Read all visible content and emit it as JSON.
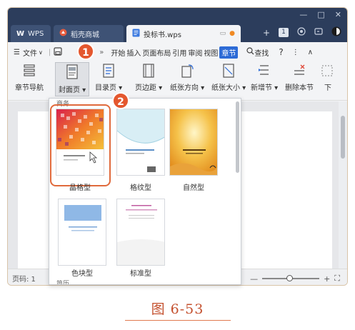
{
  "titlebar": {
    "tabs": [
      {
        "label": "WPS"
      },
      {
        "label": "稻壳商城"
      },
      {
        "label": "投标书.wps"
      }
    ],
    "window_controls": [
      "—",
      "□",
      "✕"
    ],
    "tab_count": "1"
  },
  "menu": {
    "file_label": "文件",
    "items": [
      "开始",
      "插入",
      "页面布局",
      "引用",
      "审阅",
      "视图",
      "章节"
    ],
    "search_label": "查找",
    "help": "?",
    "more": "⋮",
    "collapse": "∧"
  },
  "ribbon": {
    "chapter_nav": "章节导航",
    "cover_page": "封面页",
    "toc_page": "目录页",
    "margins": "页边距",
    "orientation": "纸张方向",
    "paper_size": "纸张大小",
    "new_section": "新增节",
    "delete_section": "删除本节",
    "next": "下"
  },
  "dropdown": {
    "section_label": "商务",
    "templates": [
      {
        "name": "晶格型"
      },
      {
        "name": "格纹型"
      },
      {
        "name": "自然型"
      },
      {
        "name": "色块型"
      },
      {
        "name": "标准型"
      }
    ],
    "placeholder_text": "[在输入文档标题]",
    "next_section_label": "简历"
  },
  "badges": {
    "step1": "1",
    "step2": "2"
  },
  "status": {
    "page_label": "页码: 1"
  },
  "zoom": {
    "minus": "—",
    "plus": "+"
  },
  "caption": "图 6-53",
  "colors": {
    "accent": "#2d6bd6",
    "badge": "#e4572e",
    "highlight": "#e06a3c",
    "titlebar": "#2c3d5c"
  }
}
